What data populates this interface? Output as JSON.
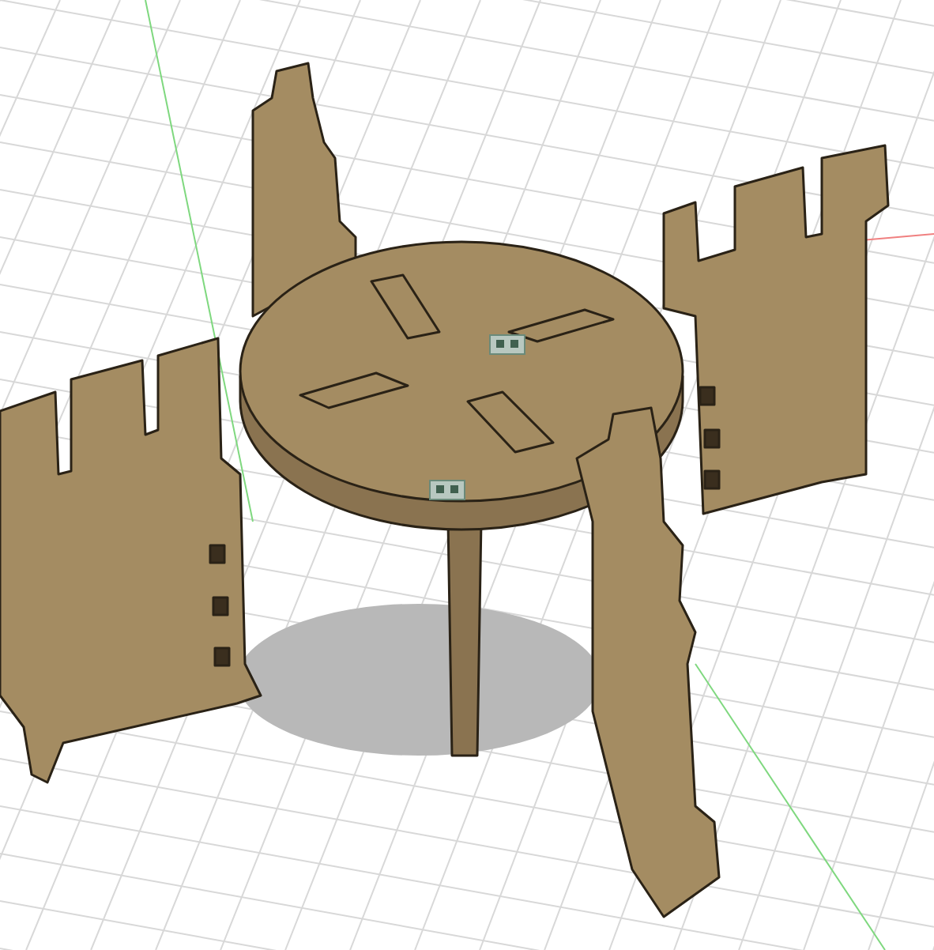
{
  "viewport": {
    "grid_visible": true,
    "joint_markers_visible": true
  }
}
